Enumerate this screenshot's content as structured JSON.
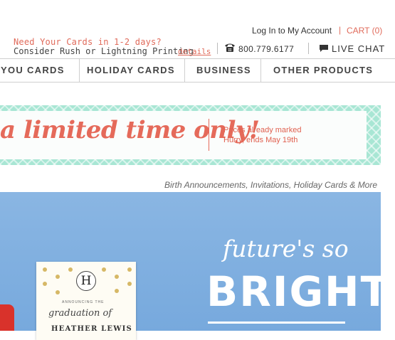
{
  "header": {
    "login_label": "Log In to My Account",
    "separator": "|",
    "cart_label": "CART (0)",
    "rush_title": "Need Your Cards in 1-2 days?",
    "rush_text": "Consider Rush or Lightning Printing",
    "details_link": "details",
    "phone_icon": "phone-icon",
    "phone_number": "800.779.6177",
    "chat_icon": "chat-bubble-icon",
    "chat_label": "LIVE CHAT"
  },
  "nav": {
    "items": [
      {
        "label": "YOU CARDS"
      },
      {
        "label": "HOLIDAY CARDS"
      },
      {
        "label": "BUSINESS"
      },
      {
        "label": "OTHER PRODUCTS"
      }
    ]
  },
  "promo": {
    "headline": "a limited time only!",
    "line1": "Prices already marked",
    "line2": "Hurry, ends May 19th"
  },
  "tagline": "Birth Announcements, Invitations, Holiday Cards & More",
  "hero": {
    "card_monogram": "H",
    "card_announcing": "ANNOUNCING THE",
    "card_script": "graduation of",
    "card_name": "HEATHER LEWIS",
    "script_text": "future's so",
    "big_text": "BRIGHT"
  },
  "colors": {
    "accent": "#e06a5a",
    "banner_pattern": "#a8e6d4",
    "hero_blue": "#80b0e0"
  }
}
